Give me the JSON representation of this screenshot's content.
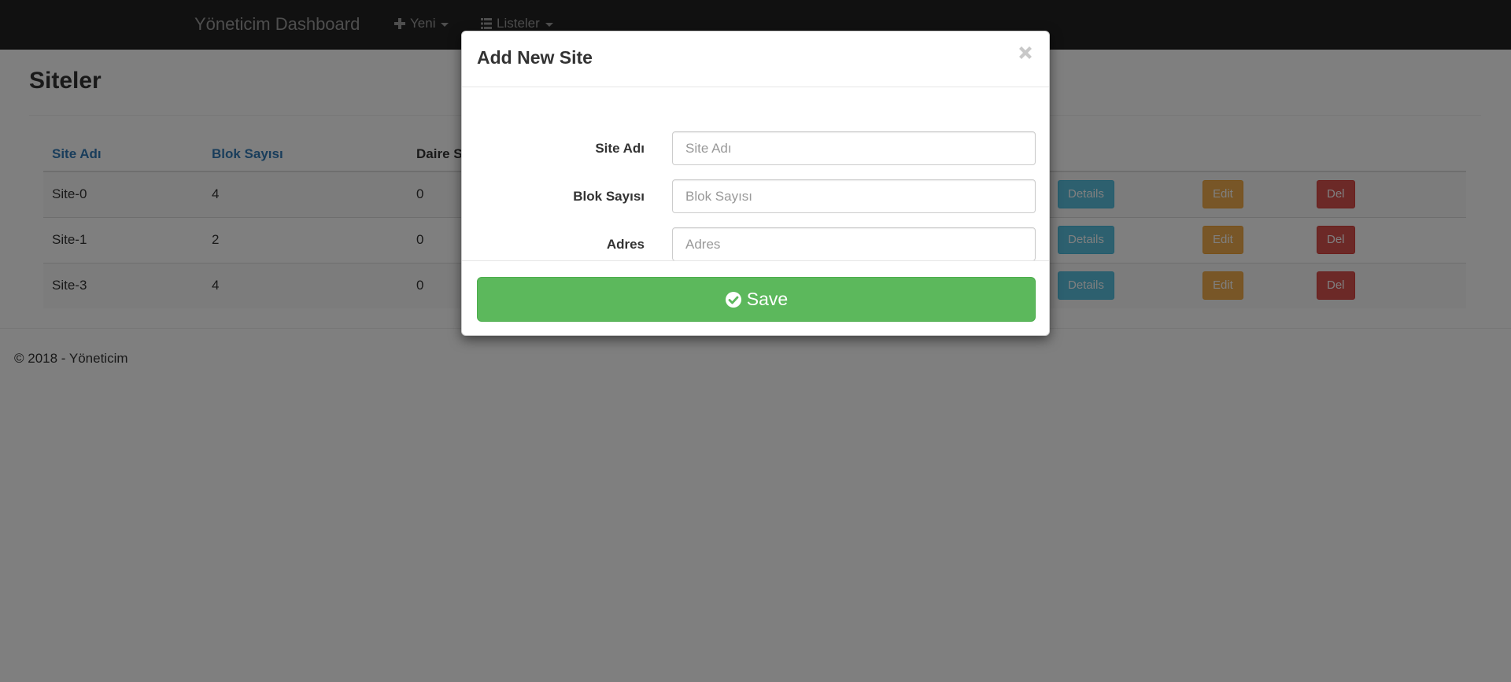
{
  "navbar": {
    "brand": "Yöneticim Dashboard",
    "items": [
      {
        "label": "Yeni",
        "icon": "plus-icon"
      },
      {
        "label": "Listeler",
        "icon": "list-icon"
      }
    ]
  },
  "page": {
    "title": "Siteler"
  },
  "table": {
    "headers": [
      "Site Adı",
      "Blok Sayısı",
      "Daire S"
    ],
    "rows": [
      {
        "site": "Site-0",
        "blok": "4",
        "daire": "0"
      },
      {
        "site": "Site-1",
        "blok": "2",
        "daire": "0"
      },
      {
        "site": "Site-3",
        "blok": "4",
        "daire": "0"
      }
    ],
    "actions": {
      "details": "Details",
      "edit": "Edit",
      "del": "Del"
    }
  },
  "footer": {
    "text": "© 2018 - Yöneticim"
  },
  "modal": {
    "title": "Add New Site",
    "close_icon": "close-icon",
    "fields": [
      {
        "label": "Site Adı",
        "placeholder": "Site Adı",
        "value": ""
      },
      {
        "label": "Blok Sayısı",
        "placeholder": "Blok Sayısı",
        "value": ""
      },
      {
        "label": "Adres",
        "placeholder": "Adres",
        "value": ""
      }
    ],
    "save_label": "Save",
    "save_icon": "check-circle-icon"
  },
  "colors": {
    "navbar_bg": "#222222",
    "link": "#337ab7",
    "info": "#5bc0de",
    "warning": "#f0ad4e",
    "danger": "#d9534f",
    "success": "#5cb85c"
  }
}
